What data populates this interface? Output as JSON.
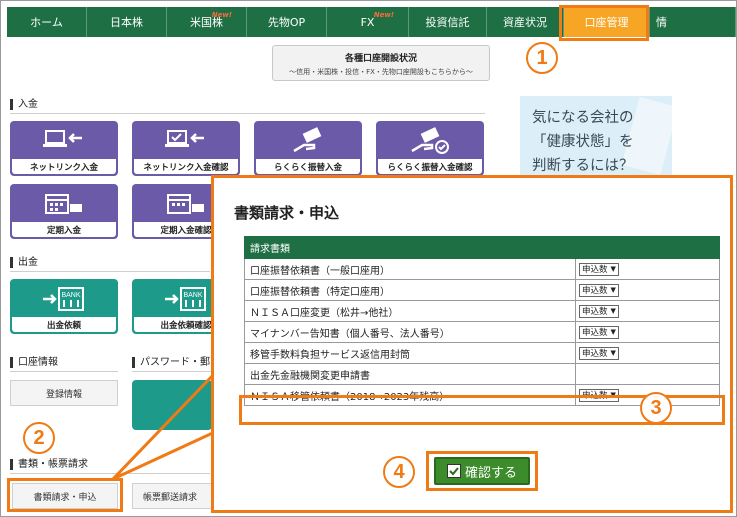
{
  "nav": {
    "items": [
      {
        "label": "ホーム",
        "badge": ""
      },
      {
        "label": "日本株",
        "badge": ""
      },
      {
        "label": "米国株",
        "badge": "New!"
      },
      {
        "label": "先物OP",
        "badge": ""
      },
      {
        "label": "FX",
        "badge": "New!"
      },
      {
        "label": "投資信託",
        "badge": ""
      },
      {
        "label": "資産状況",
        "badge": ""
      },
      {
        "label": "口座管理",
        "badge": ""
      },
      {
        "label": "情",
        "badge": ""
      }
    ]
  },
  "status_button": {
    "title": "各種口座開設状況",
    "subtitle": "〜信用・米国株・投信・FX・先物口座開設もこちらから〜"
  },
  "deposit": {
    "title": "入金",
    "tiles": [
      {
        "label": "ネットリンク入金",
        "icon": "laptop-arrow-icon"
      },
      {
        "label": "ネットリンク入金確認",
        "icon": "laptop-check-arrow-icon"
      },
      {
        "label": "らくらく振替入金",
        "icon": "hand-card-icon"
      },
      {
        "label": "らくらく振替入金確認",
        "icon": "hand-card-check-icon"
      },
      {
        "label": "定期入金",
        "icon": "calendar-money-icon"
      },
      {
        "label": "定期入金確認",
        "icon": "calendar-money-check-icon"
      }
    ]
  },
  "withdraw": {
    "title": "出金",
    "tiles": [
      {
        "label": "出金依頼",
        "icon": "bank-arrow-icon",
        "bank_text": "BANK"
      },
      {
        "label": "出金依頼確認",
        "icon": "bank-arrow-check-icon",
        "bank_text": "BANK"
      }
    ]
  },
  "account_info": {
    "title": "口座情報",
    "button": "登録情報"
  },
  "password": {
    "title": "パスワード・郵"
  },
  "documents": {
    "title": "書類・帳票請求",
    "buttons": [
      "書類請求・申込",
      "帳票郵送請求"
    ]
  },
  "ad": {
    "lines": [
      "気になる会社の",
      "「健康状態」を",
      "判断するには？"
    ]
  },
  "callouts": [
    "1",
    "2",
    "3",
    "4"
  ],
  "popup": {
    "title": "書類請求・申込",
    "table_header": "請求書類",
    "rows": [
      {
        "name": "口座振替依頼書（一般口座用）",
        "select": "申込数"
      },
      {
        "name": "口座振替依頼書（特定口座用）",
        "select": "申込数"
      },
      {
        "name": "ＮＩＳＡ口座変更（松井→他社）",
        "select": "申込数"
      },
      {
        "name": "マイナンバー告知書（個人番号、法人番号）",
        "select": "申込数"
      },
      {
        "name": "移管手数料負担サービス返信用封筒",
        "select": "申込数"
      },
      {
        "name": "出金先金融機関変更申請書",
        "select": ""
      },
      {
        "name": "ＮＩＳＡ移管依頼書（2018→2023年残高）",
        "select": "申込数"
      }
    ],
    "confirm_label": "確認する"
  },
  "colors": {
    "nav_bg": "#1e6f44",
    "nav_active": "#f6a524",
    "accent_orange": "#f07a14",
    "tile_purple": "#6a5aa8",
    "tile_teal": "#1d9a8a",
    "confirm_green": "#3c8c2c"
  }
}
